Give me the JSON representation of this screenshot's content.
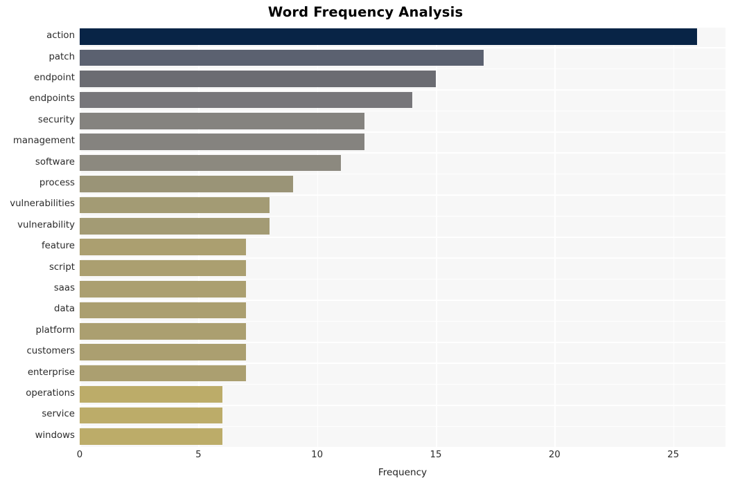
{
  "chart_data": {
    "type": "bar",
    "orientation": "horizontal",
    "title": "Word Frequency Analysis",
    "xlabel": "Frequency",
    "ylabel": "",
    "categories": [
      "action",
      "patch",
      "endpoint",
      "endpoints",
      "security",
      "management",
      "software",
      "process",
      "vulnerabilities",
      "vulnerability",
      "feature",
      "script",
      "saas",
      "data",
      "platform",
      "customers",
      "enterprise",
      "operations",
      "service",
      "windows"
    ],
    "values": [
      26,
      17,
      15,
      14,
      12,
      12,
      11,
      9,
      8,
      8,
      7,
      7,
      7,
      7,
      7,
      7,
      7,
      6,
      6,
      6
    ],
    "bar_colors": [
      "#082446",
      "#5b6170",
      "#6b6c72",
      "#77767a",
      "#85837f",
      "#85837f",
      "#8c897f",
      "#9a9477",
      "#a39b74",
      "#a39b74",
      "#ab9f70",
      "#ab9f70",
      "#ab9f70",
      "#ab9f70",
      "#ab9f70",
      "#ab9f70",
      "#ab9f70",
      "#bcac69",
      "#bcac69",
      "#bcac69"
    ],
    "xlim": [
      0,
      27.2
    ],
    "xticks": [
      0,
      5,
      10,
      15,
      20,
      25
    ],
    "xtick_labels": [
      "0",
      "5",
      "10",
      "15",
      "20",
      "25"
    ],
    "grid": true,
    "grid_color": "#ffffff",
    "plot_background": "#f7f7f7",
    "figure_background": "#ffffff",
    "legend": null,
    "title_color": "#000000",
    "tick_label_color": "#2b2b2b"
  }
}
